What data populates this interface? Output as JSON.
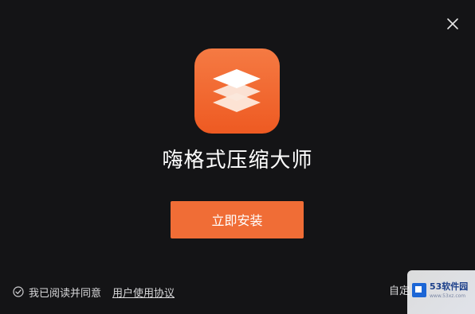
{
  "window": {
    "close_icon": "close-icon"
  },
  "app": {
    "icon": "layers-app-icon",
    "title": "嗨格式压缩大师"
  },
  "install_button": {
    "label": "立即安装"
  },
  "agreement": {
    "checkbox_checked": true,
    "check_icon": "check-circle-icon",
    "text": "我已阅读并同意",
    "link": "用户使用协议"
  },
  "footer": {
    "custom_install": "自定"
  },
  "watermark": {
    "text": "53软件园",
    "subtext": "www.53xz.com"
  },
  "colors": {
    "background": "#141416",
    "accent": "#f06d36",
    "icon_gradient_top": "#f57a43",
    "icon_gradient_bottom": "#ee5a22",
    "text": "#ffffff",
    "muted_text": "#d7d7d9"
  }
}
